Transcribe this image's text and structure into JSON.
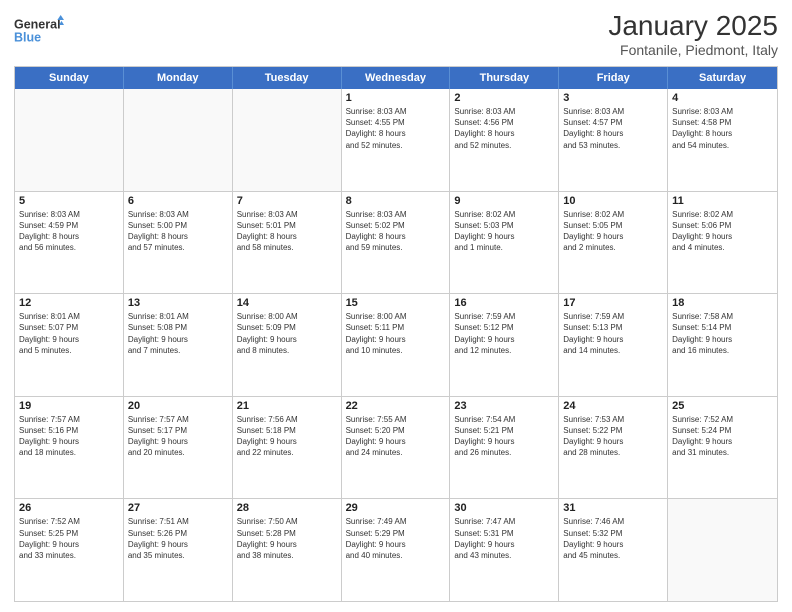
{
  "header": {
    "logo_line1": "General",
    "logo_line2": "Blue",
    "title": "January 2025",
    "subtitle": "Fontanile, Piedmont, Italy"
  },
  "weekdays": [
    "Sunday",
    "Monday",
    "Tuesday",
    "Wednesday",
    "Thursday",
    "Friday",
    "Saturday"
  ],
  "weeks": [
    [
      {
        "day": "",
        "info": ""
      },
      {
        "day": "",
        "info": ""
      },
      {
        "day": "",
        "info": ""
      },
      {
        "day": "1",
        "info": "Sunrise: 8:03 AM\nSunset: 4:55 PM\nDaylight: 8 hours\nand 52 minutes."
      },
      {
        "day": "2",
        "info": "Sunrise: 8:03 AM\nSunset: 4:56 PM\nDaylight: 8 hours\nand 52 minutes."
      },
      {
        "day": "3",
        "info": "Sunrise: 8:03 AM\nSunset: 4:57 PM\nDaylight: 8 hours\nand 53 minutes."
      },
      {
        "day": "4",
        "info": "Sunrise: 8:03 AM\nSunset: 4:58 PM\nDaylight: 8 hours\nand 54 minutes."
      }
    ],
    [
      {
        "day": "5",
        "info": "Sunrise: 8:03 AM\nSunset: 4:59 PM\nDaylight: 8 hours\nand 56 minutes."
      },
      {
        "day": "6",
        "info": "Sunrise: 8:03 AM\nSunset: 5:00 PM\nDaylight: 8 hours\nand 57 minutes."
      },
      {
        "day": "7",
        "info": "Sunrise: 8:03 AM\nSunset: 5:01 PM\nDaylight: 8 hours\nand 58 minutes."
      },
      {
        "day": "8",
        "info": "Sunrise: 8:03 AM\nSunset: 5:02 PM\nDaylight: 8 hours\nand 59 minutes."
      },
      {
        "day": "9",
        "info": "Sunrise: 8:02 AM\nSunset: 5:03 PM\nDaylight: 9 hours\nand 1 minute."
      },
      {
        "day": "10",
        "info": "Sunrise: 8:02 AM\nSunset: 5:05 PM\nDaylight: 9 hours\nand 2 minutes."
      },
      {
        "day": "11",
        "info": "Sunrise: 8:02 AM\nSunset: 5:06 PM\nDaylight: 9 hours\nand 4 minutes."
      }
    ],
    [
      {
        "day": "12",
        "info": "Sunrise: 8:01 AM\nSunset: 5:07 PM\nDaylight: 9 hours\nand 5 minutes."
      },
      {
        "day": "13",
        "info": "Sunrise: 8:01 AM\nSunset: 5:08 PM\nDaylight: 9 hours\nand 7 minutes."
      },
      {
        "day": "14",
        "info": "Sunrise: 8:00 AM\nSunset: 5:09 PM\nDaylight: 9 hours\nand 8 minutes."
      },
      {
        "day": "15",
        "info": "Sunrise: 8:00 AM\nSunset: 5:11 PM\nDaylight: 9 hours\nand 10 minutes."
      },
      {
        "day": "16",
        "info": "Sunrise: 7:59 AM\nSunset: 5:12 PM\nDaylight: 9 hours\nand 12 minutes."
      },
      {
        "day": "17",
        "info": "Sunrise: 7:59 AM\nSunset: 5:13 PM\nDaylight: 9 hours\nand 14 minutes."
      },
      {
        "day": "18",
        "info": "Sunrise: 7:58 AM\nSunset: 5:14 PM\nDaylight: 9 hours\nand 16 minutes."
      }
    ],
    [
      {
        "day": "19",
        "info": "Sunrise: 7:57 AM\nSunset: 5:16 PM\nDaylight: 9 hours\nand 18 minutes."
      },
      {
        "day": "20",
        "info": "Sunrise: 7:57 AM\nSunset: 5:17 PM\nDaylight: 9 hours\nand 20 minutes."
      },
      {
        "day": "21",
        "info": "Sunrise: 7:56 AM\nSunset: 5:18 PM\nDaylight: 9 hours\nand 22 minutes."
      },
      {
        "day": "22",
        "info": "Sunrise: 7:55 AM\nSunset: 5:20 PM\nDaylight: 9 hours\nand 24 minutes."
      },
      {
        "day": "23",
        "info": "Sunrise: 7:54 AM\nSunset: 5:21 PM\nDaylight: 9 hours\nand 26 minutes."
      },
      {
        "day": "24",
        "info": "Sunrise: 7:53 AM\nSunset: 5:22 PM\nDaylight: 9 hours\nand 28 minutes."
      },
      {
        "day": "25",
        "info": "Sunrise: 7:52 AM\nSunset: 5:24 PM\nDaylight: 9 hours\nand 31 minutes."
      }
    ],
    [
      {
        "day": "26",
        "info": "Sunrise: 7:52 AM\nSunset: 5:25 PM\nDaylight: 9 hours\nand 33 minutes."
      },
      {
        "day": "27",
        "info": "Sunrise: 7:51 AM\nSunset: 5:26 PM\nDaylight: 9 hours\nand 35 minutes."
      },
      {
        "day": "28",
        "info": "Sunrise: 7:50 AM\nSunset: 5:28 PM\nDaylight: 9 hours\nand 38 minutes."
      },
      {
        "day": "29",
        "info": "Sunrise: 7:49 AM\nSunset: 5:29 PM\nDaylight: 9 hours\nand 40 minutes."
      },
      {
        "day": "30",
        "info": "Sunrise: 7:47 AM\nSunset: 5:31 PM\nDaylight: 9 hours\nand 43 minutes."
      },
      {
        "day": "31",
        "info": "Sunrise: 7:46 AM\nSunset: 5:32 PM\nDaylight: 9 hours\nand 45 minutes."
      },
      {
        "day": "",
        "info": ""
      }
    ]
  ]
}
